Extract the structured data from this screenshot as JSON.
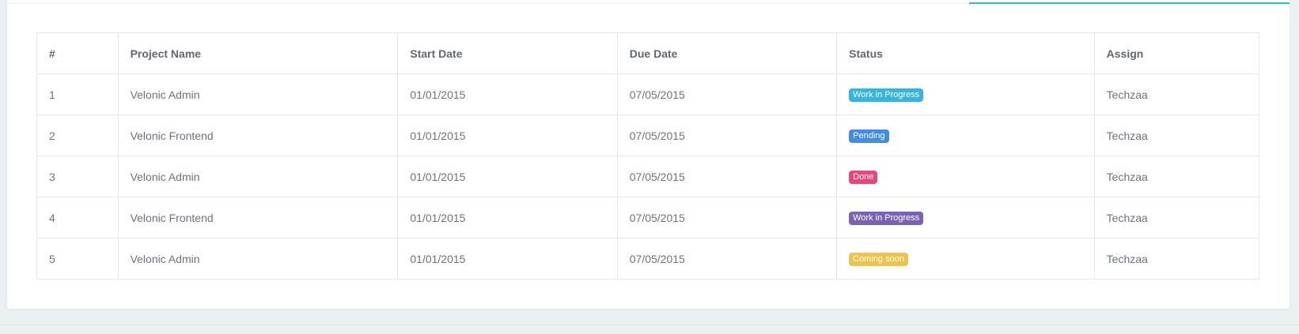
{
  "table": {
    "headers": [
      "#",
      "Project Name",
      "Start Date",
      "Due Date",
      "Status",
      "Assign"
    ],
    "rows": [
      {
        "num": "1",
        "project": "Velonic Admin",
        "start": "01/01/2015",
        "due": "07/05/2015",
        "status": "Work in Progress",
        "status_color": "#34b5e0",
        "assign": "Techzaa"
      },
      {
        "num": "2",
        "project": "Velonic Frontend",
        "start": "01/01/2015",
        "due": "07/05/2015",
        "status": "Pending",
        "status_color": "#3f8ce6",
        "assign": "Techzaa"
      },
      {
        "num": "3",
        "project": "Velonic Admin",
        "start": "01/01/2015",
        "due": "07/05/2015",
        "status": "Done",
        "status_color": "#ec457a",
        "assign": "Techzaa"
      },
      {
        "num": "4",
        "project": "Velonic Frontend",
        "start": "01/01/2015",
        "due": "07/05/2015",
        "status": "Work in Progress",
        "status_color": "#7b61b5",
        "assign": "Techzaa"
      },
      {
        "num": "5",
        "project": "Velonic Admin",
        "start": "01/01/2015",
        "due": "07/05/2015",
        "status": "Coming soon",
        "status_color": "#eec34a",
        "assign": "Techzaa"
      }
    ]
  },
  "colors": {
    "accent": "#22c5c7",
    "background": "#ebf1f3",
    "panel": "#ffffff",
    "border": "#e4e8ea"
  }
}
